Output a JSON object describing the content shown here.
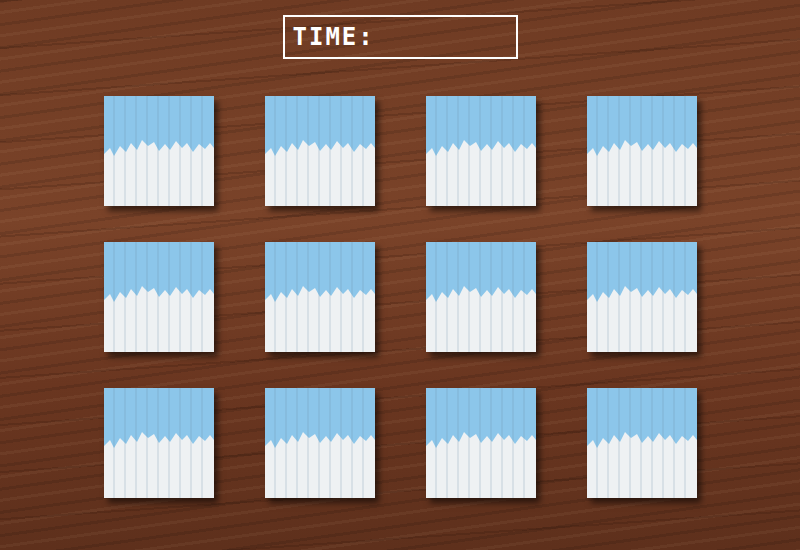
{
  "timer": {
    "label": "TIME:",
    "value": ""
  },
  "cards": [
    {
      "flipped": false
    },
    {
      "flipped": false
    },
    {
      "flipped": false
    },
    {
      "flipped": false
    },
    {
      "flipped": false
    },
    {
      "flipped": false
    },
    {
      "flipped": false
    },
    {
      "flipped": false
    },
    {
      "flipped": false
    },
    {
      "flipped": false
    },
    {
      "flipped": false
    },
    {
      "flipped": false
    }
  ]
}
